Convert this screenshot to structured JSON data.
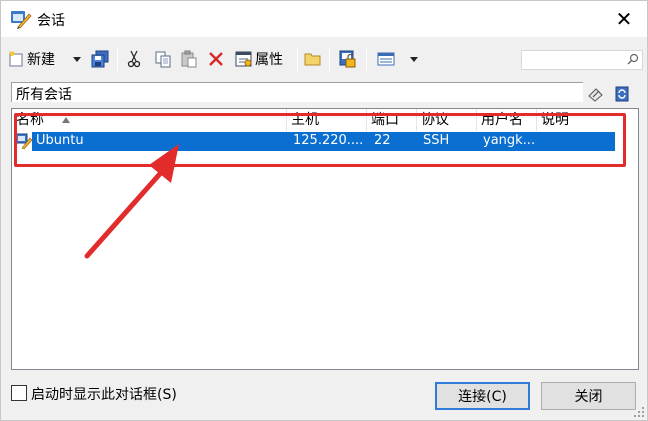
{
  "window": {
    "title": "会话",
    "close_symbol": "✕"
  },
  "toolbar": {
    "new_label": "新建",
    "properties_label": "属性",
    "search_placeholder": ""
  },
  "group": {
    "label": "所有会话"
  },
  "columns": [
    "名称",
    "主机",
    "端口",
    "协议",
    "用户名",
    "说明"
  ],
  "sessions": [
    {
      "name": "Ubuntu",
      "host": "125.220....",
      "port": "22",
      "protocol": "SSH",
      "user": "yangk...",
      "note": ""
    }
  ],
  "footer": {
    "show_on_startup_label": "启动时显示此对话框(S)",
    "show_on_startup_checked": false,
    "connect_label": "连接(C)",
    "close_label": "关闭"
  },
  "colors": {
    "selection": "#0a6fd0",
    "annotation": "#e22b2b"
  },
  "icons": [
    "app-icon",
    "new-session-icon",
    "dropdown-icon",
    "save-icon",
    "cut-icon",
    "copy-icon",
    "paste-icon",
    "delete-icon",
    "properties-icon",
    "folder-icon",
    "lock-icon",
    "view-icon",
    "search-icon",
    "link-icon",
    "refresh-icon",
    "session-icon",
    "sort-asc-icon",
    "arrow-annotation"
  ]
}
